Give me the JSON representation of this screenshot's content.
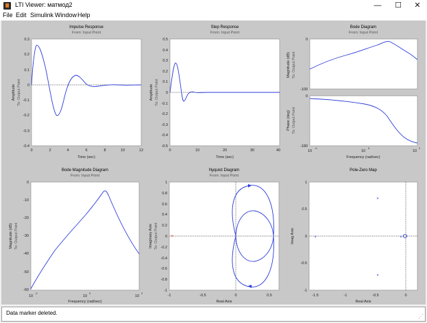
{
  "window": {
    "title": "LTI Viewer: матмод2",
    "minimize_glyph": "—",
    "maximize_glyph": "☐",
    "close_glyph": "✕"
  },
  "menu": [
    "File",
    "Edit",
    "Simulink",
    "Window",
    "Help"
  ],
  "status": {
    "text": "Data marker deleted."
  },
  "colors": {
    "curve": "#2a3bd8",
    "background": "#c8c8c8",
    "axes": "#ffffff"
  },
  "plots": {
    "impulse": {
      "title": "Impulse Response",
      "subtitle": "From: Input Point",
      "ylabel": "Amplitude",
      "ylabel2": "To: Output Point",
      "xlabel": "Time (sec)",
      "xticks": [
        "0",
        "2",
        "4",
        "6",
        "8",
        "10",
        "12"
      ],
      "yticks": [
        "0.3",
        "0.2",
        "0.1",
        "0",
        "-0.1",
        "-0.2",
        "-0.3",
        "-0.4"
      ]
    },
    "step": {
      "title": "Step Response",
      "subtitle": "From: Input Point",
      "ylabel": "Amplitude",
      "ylabel2": "To: Output Point",
      "xlabel": "Time (sec)",
      "xticks": [
        "0",
        "10",
        "20",
        "30",
        "40"
      ],
      "yticks": [
        "0.5",
        "0.4",
        "0.3",
        "0.2",
        "0.1",
        "0",
        "-0.1",
        "-0.2",
        "-0.3",
        "-0.4",
        "-0.5"
      ]
    },
    "bode": {
      "title": "Bode Diagram",
      "subtitle": "From: Input Point",
      "mag_ylabel": "Magnitude (dB)",
      "phase_ylabel": "Phase (deg)",
      "ylabel2": "To: Output Point",
      "xlabel": "Frequency (rad/sec)",
      "mag_yticks": [
        "0",
        "-100"
      ],
      "phase_yticks": [
        "0",
        "-180"
      ],
      "xticks": [
        "10",
        "10",
        "10"
      ],
      "xexp": [
        "-2",
        "0",
        "2"
      ]
    },
    "bodemag": {
      "title": "Bode Magnitude Diagram",
      "subtitle": "From: Input Point",
      "ylabel": "Magnitude (dB)",
      "ylabel2": "To: Output Point",
      "xlabel": "Frequency (rad/sec)",
      "yticks": [
        "0",
        "-10",
        "-20",
        "-30",
        "-40",
        "-50",
        "-60"
      ],
      "xticks": [
        "10",
        "10",
        "10"
      ],
      "xexp": [
        "-2",
        "0",
        "2"
      ]
    },
    "nyquist": {
      "title": "Nyquist Diagram",
      "subtitle": "From: Input Point",
      "ylabel": "Imaginary Axis",
      "ylabel2": "To: Output Point",
      "xlabel": "Real Axis",
      "xticks": [
        "-1",
        "-0.5",
        "0",
        "0.5"
      ],
      "yticks": [
        "1",
        "0.8",
        "0.6",
        "0.4",
        "0.2",
        "0",
        "-0.2",
        "-0.4",
        "-0.6",
        "-0.8",
        "-1"
      ]
    },
    "pzmap": {
      "title": "Pole-Zero Map",
      "ylabel": "Imag Axis",
      "xlabel": "Real Axis",
      "xticks": [
        "-1.5",
        "-1",
        "-0.5",
        "0"
      ],
      "yticks": [
        "1",
        "0.5",
        "0",
        "-0.5",
        "-1"
      ]
    }
  }
}
